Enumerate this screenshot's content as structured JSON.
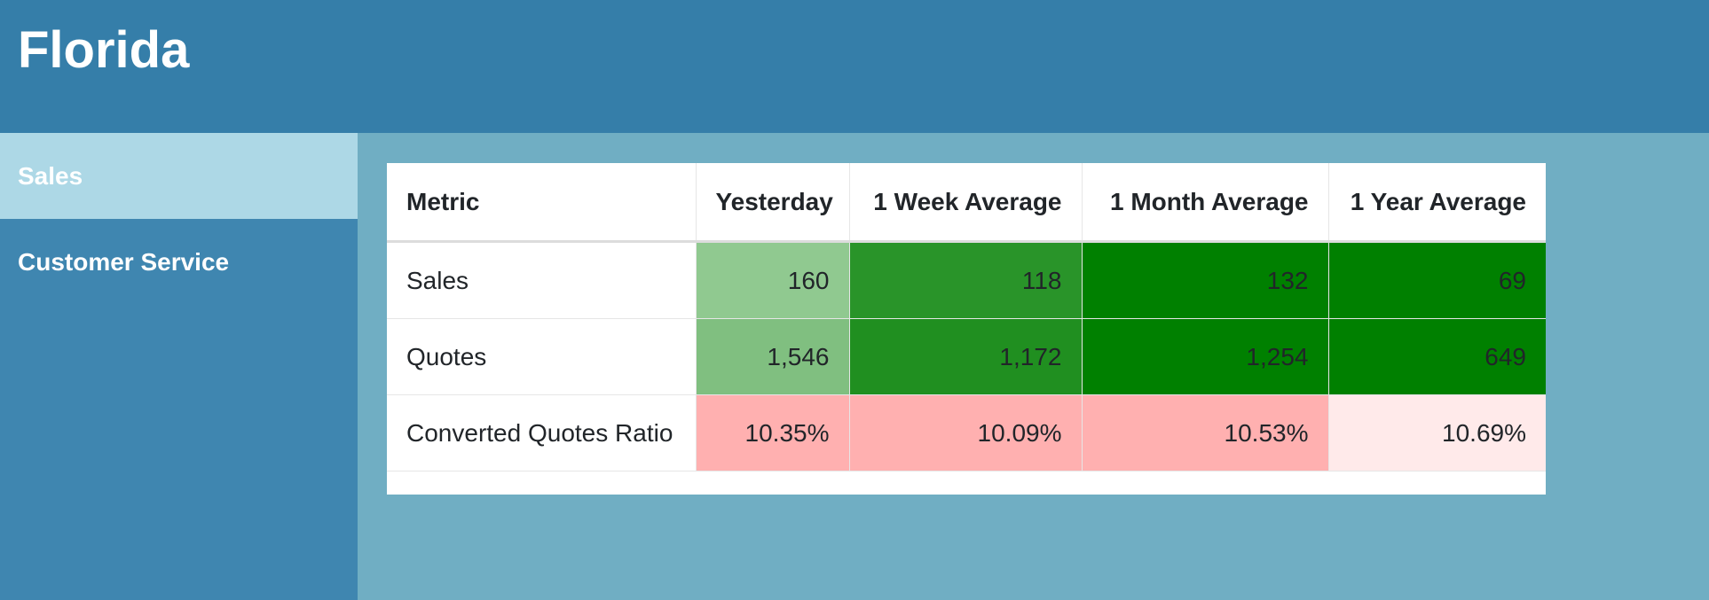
{
  "header": {
    "title": "Florida"
  },
  "sidebar": {
    "items": [
      {
        "label": "Sales",
        "active": true
      },
      {
        "label": "Customer Service",
        "active": false
      }
    ]
  },
  "table": {
    "columns": [
      "Metric",
      "Yesterday",
      "1 Week Average",
      "1 Month Average",
      "1 Year Average"
    ],
    "rows": [
      {
        "metric": "Sales",
        "cells": [
          {
            "value": "160",
            "color": "#90c990"
          },
          {
            "value": "118",
            "color": "#299429"
          },
          {
            "value": "132",
            "color": "#008000"
          },
          {
            "value": "69",
            "color": "#008000"
          }
        ]
      },
      {
        "metric": "Quotes",
        "cells": [
          {
            "value": "1,546",
            "color": "#80bf80"
          },
          {
            "value": "1,172",
            "color": "#208f20"
          },
          {
            "value": "1,254",
            "color": "#008000"
          },
          {
            "value": "649",
            "color": "#008000"
          }
        ]
      },
      {
        "metric": "Converted Quotes Ratio",
        "cells": [
          {
            "value": "10.35%",
            "color": "#ffb0b0"
          },
          {
            "value": "10.09%",
            "color": "#ffb0b0"
          },
          {
            "value": "10.53%",
            "color": "#ffb0b0"
          },
          {
            "value": "10.69%",
            "color": "#ffeaea"
          }
        ]
      }
    ]
  },
  "colors": {
    "header_bg": "#357ea9",
    "sidebar_bg": "#3f86b0",
    "sidebar_active_bg": "#add8e6",
    "main_bg": "#70aec3"
  }
}
